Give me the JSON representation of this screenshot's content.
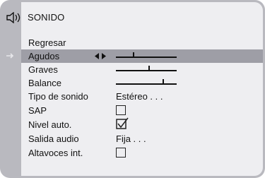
{
  "menu": {
    "title": "SONIDO",
    "items": [
      {
        "id": "regresar",
        "label": "Regresar"
      },
      {
        "id": "agudos",
        "label": "Agudos",
        "selected": true,
        "level": 0.28
      },
      {
        "id": "graves",
        "label": "Graves",
        "level": 0.55
      },
      {
        "id": "balance",
        "label": "Balance",
        "level": 0.78
      },
      {
        "id": "tipo",
        "label": "Tipo de sonido",
        "value": "Estéreo . . ."
      },
      {
        "id": "sap",
        "label": "SAP",
        "checked": false
      },
      {
        "id": "nivel",
        "label": "Nivel auto.",
        "checked": true
      },
      {
        "id": "salida",
        "label": "Salida audio",
        "value": "Fija . . ."
      },
      {
        "id": "altavoces",
        "label": "Altavoces int.",
        "checked": false
      }
    ]
  },
  "colors": {
    "frame": "#b9b9bf",
    "panel": "#eeeef1",
    "selected_row": "#9e9ea6",
    "text": "#111111"
  }
}
